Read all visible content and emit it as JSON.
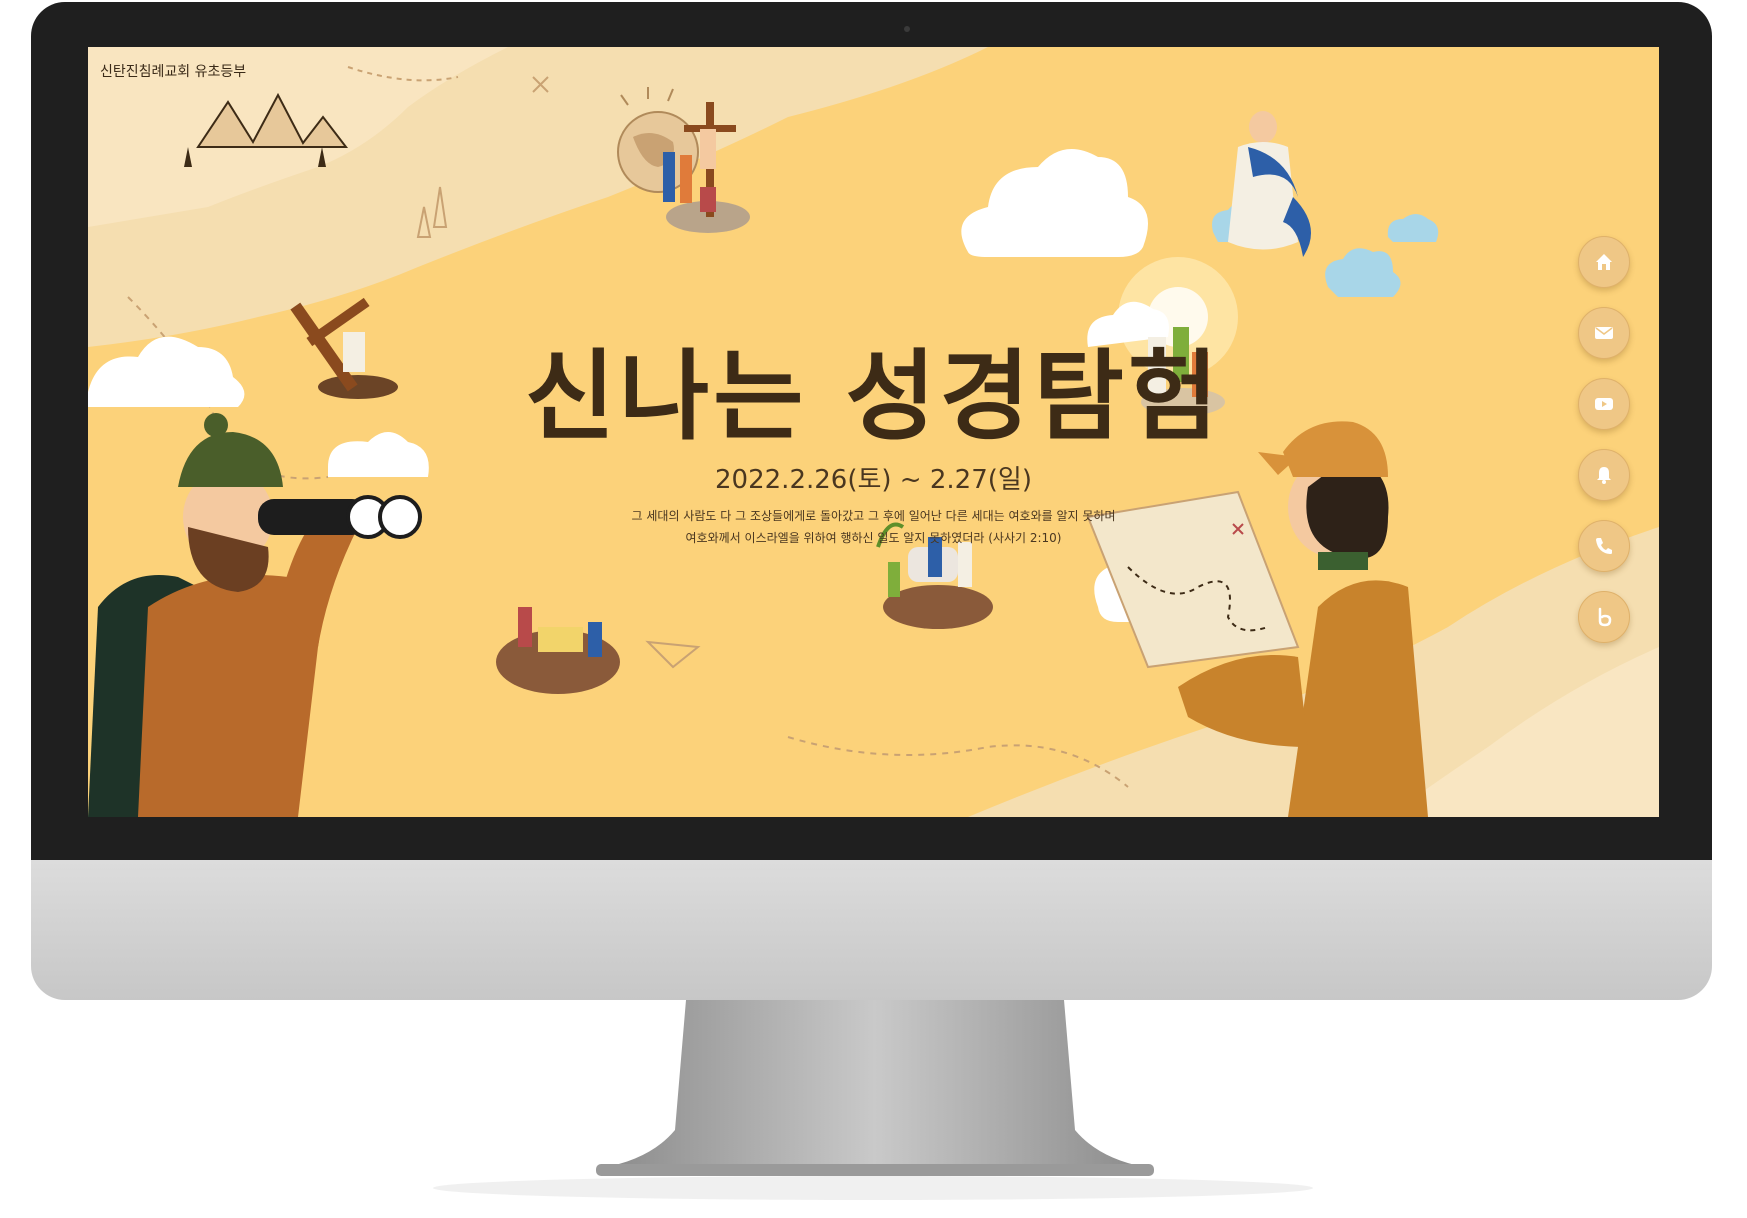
{
  "site": {
    "church_name": "신탄진침례교회 유초등부"
  },
  "hero": {
    "title": "신나는 성경탐험",
    "date": "2022.2.26(토) ~ 2.27(일)",
    "verse_line1": "그 세대의 사람도 다 그 조상들에게로 돌아갔고 그 후에 일어난 다른 세대는 여호와를 알지 못하며",
    "verse_line2": "여호와께서 이스라엘을 위하여 행하신 일도 알지 못하였더라 (사사기 2:10)"
  },
  "side_menu": [
    {
      "icon": "home-icon"
    },
    {
      "icon": "mail-icon"
    },
    {
      "icon": "youtube-icon"
    },
    {
      "icon": "bell-icon"
    },
    {
      "icon": "phone-icon"
    },
    {
      "icon": "band-icon"
    }
  ],
  "colors": {
    "background": "#fcd27a",
    "title": "#3d2b16",
    "button": "#efc786",
    "bezel": "#1f1f1f"
  }
}
